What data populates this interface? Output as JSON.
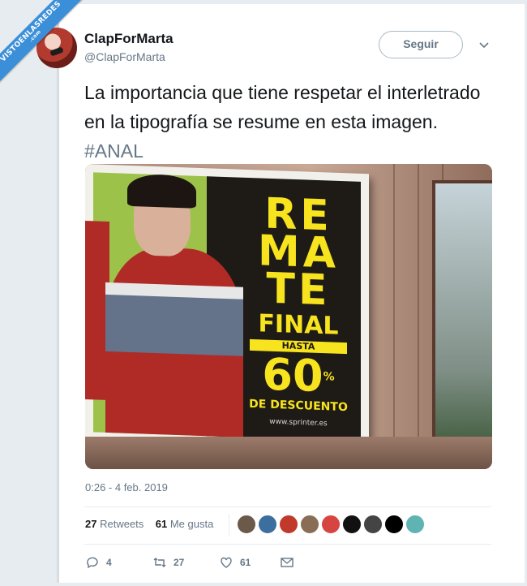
{
  "watermark": {
    "line1": "VISTOENLASREDES",
    "line2": ".com"
  },
  "tweet": {
    "author_name": "ClapForMarta",
    "author_handle": "@ClapForMarta",
    "follow_label": "Seguir",
    "text": "La importancia que tiene respetar el interletrado en la tipografía se resume en esta imagen. ",
    "hashtag": "#ANAL",
    "timestamp": "0:26 - 4 feb. 2019",
    "retweets_count": "27",
    "retweets_label": "Retweets",
    "likes_count": "61",
    "likes_label": "Me gusta",
    "actions": {
      "replies": "4",
      "retweets": "27",
      "likes": "61"
    }
  },
  "photo": {
    "sign_lines": [
      "RE",
      "MA",
      "TE"
    ],
    "sign_final": "FINAL",
    "sign_hasta": "HASTA",
    "sign_percent": "60",
    "sign_percent_symbol": "%",
    "sign_desc": "DE DESCUENTO",
    "sign_url": "www.sprinter.es"
  },
  "likers": [
    {
      "name": "liker-avatar-1",
      "color": "#6b5a4a"
    },
    {
      "name": "liker-avatar-2",
      "color": "#3d6f9e"
    },
    {
      "name": "liker-avatar-3",
      "color": "#c0392b"
    },
    {
      "name": "liker-avatar-4",
      "color": "#8a6d55"
    },
    {
      "name": "liker-avatar-5",
      "color": "#d64541"
    },
    {
      "name": "liker-avatar-6",
      "color": "#111111"
    },
    {
      "name": "liker-avatar-7",
      "color": "#444444"
    },
    {
      "name": "liker-avatar-8",
      "color": "#000000"
    },
    {
      "name": "liker-avatar-9",
      "color": "#5fb3b3"
    }
  ],
  "colors": {
    "accent": "#1da1f2",
    "muted": "#657786",
    "text": "#14171a"
  }
}
